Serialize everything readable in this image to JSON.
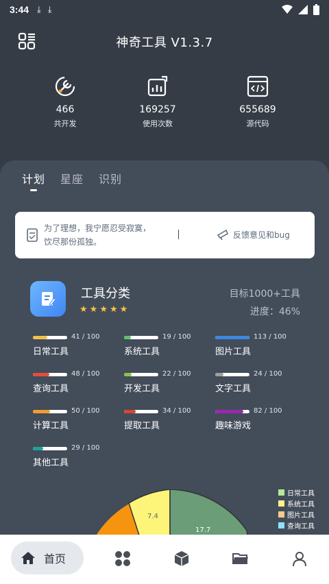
{
  "status": {
    "time": "3:44",
    "download_icons": [
      "download-icon",
      "download-icon"
    ],
    "right_icons": [
      "wifi-icon",
      "signal-icon",
      "battery-icon"
    ]
  },
  "header": {
    "title": "神奇工具 V1.3.7",
    "menu_icon": "apps-grid-icon"
  },
  "stats": [
    {
      "icon": "wrench-icon",
      "value": "466",
      "label": "共开发"
    },
    {
      "icon": "chart-icon",
      "value": "169257",
      "label": "使用次数"
    },
    {
      "icon": "code-icon",
      "value": "655689",
      "label": "源代码"
    }
  ],
  "tabs": [
    {
      "label": "计划",
      "active": true
    },
    {
      "label": "星座",
      "active": false
    },
    {
      "label": "识别",
      "active": false
    }
  ],
  "notice": {
    "quote": "为了理想，我宁愿忍受寂寞，饮尽那份孤独。",
    "separator": "|",
    "feedback_label": "反馈意见和bug"
  },
  "category": {
    "title": "工具分类",
    "stars": 5,
    "goal": "目标1000+工具",
    "progress": "进度：46%"
  },
  "categories": [
    {
      "name": "日常工具",
      "count": "41 / 100",
      "value": 41,
      "color": "#f5c04a"
    },
    {
      "name": "系统工具",
      "count": "19 / 100",
      "value": 19,
      "color": "#5cc36b"
    },
    {
      "name": "图片工具",
      "count": "113 / 100",
      "value": 113,
      "color": "#3d87e0"
    },
    {
      "name": "查询工具",
      "count": "48 / 100",
      "value": 48,
      "color": "#e44d3a"
    },
    {
      "name": "开发工具",
      "count": "22 / 100",
      "value": 22,
      "color": "#8bc34a"
    },
    {
      "name": "文字工具",
      "count": "24 / 100",
      "value": 24,
      "color": "#9e9e9e"
    },
    {
      "name": "计算工具",
      "count": "50 / 100",
      "value": 50,
      "color": "#f39c2d"
    },
    {
      "name": "提取工具",
      "count": "34 / 100",
      "value": 34,
      "color": "#d84335"
    },
    {
      "name": "趣味游戏",
      "count": "82 / 100",
      "value": 82,
      "color": "#9c27b0"
    },
    {
      "name": "其他工具",
      "count": "29 / 100",
      "value": 29,
      "color": "#1aa59a"
    }
  ],
  "pie": {
    "visible_labels": [
      "7.4",
      "17.7"
    ],
    "legend": [
      {
        "label": "日常工具",
        "color": "#b6e89a"
      },
      {
        "label": "系统工具",
        "color": "#fff38a"
      },
      {
        "label": "图片工具",
        "color": "#f7c98f"
      },
      {
        "label": "查询工具",
        "color": "#8fe2ff"
      }
    ]
  },
  "bottom_nav": [
    {
      "label": "首页",
      "icon": "home-icon",
      "active": true
    },
    {
      "label": "",
      "icon": "grid-icon",
      "active": false
    },
    {
      "label": "",
      "icon": "cube-icon",
      "active": false
    },
    {
      "label": "",
      "icon": "folder-icon",
      "active": false
    },
    {
      "label": "",
      "icon": "person-icon",
      "active": false
    }
  ]
}
